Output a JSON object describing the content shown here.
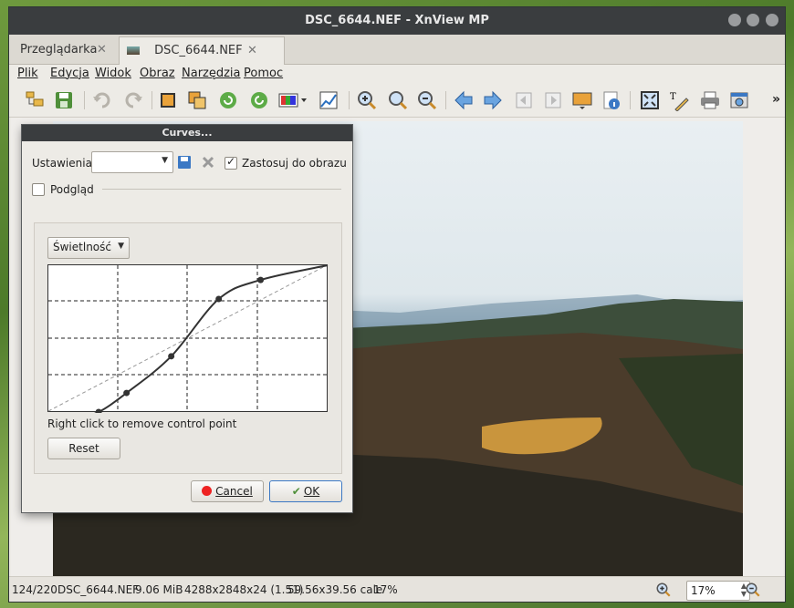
{
  "window": {
    "title": "DSC_6644.NEF - XnView MP"
  },
  "tabs": [
    {
      "label": "Przeglądarka"
    },
    {
      "label": "DSC_6644.NEF"
    }
  ],
  "menu": [
    "Plik",
    "Edycja",
    "Widok",
    "Obraz",
    "Narzędzia",
    "Pomoc"
  ],
  "toolbar": {
    "icons": [
      "folder-tree-icon",
      "save-icon",
      "undo-icon",
      "redo-icon",
      "crop-icon",
      "resize-icon",
      "rotate-left-icon",
      "rotate-right-icon",
      "color-adjust-icon",
      "levels-icon",
      "zoom-in-icon",
      "zoom-fit-icon",
      "zoom-out-icon",
      "prev-icon",
      "next-icon",
      "first-icon",
      "last-icon",
      "slideshow-icon",
      "info-icon",
      "fullscreen-icon",
      "text-edit-icon",
      "print-icon",
      "capture-icon"
    ],
    "overflow": "»"
  },
  "dialog": {
    "title": "Curves...",
    "settings_label": "Ustawienia:",
    "settings_value": "",
    "apply_label": "Zastosuj do obrazu",
    "apply_checked": true,
    "preview_label": "Podgląd",
    "preview_checked": false,
    "channel": "Świetlność",
    "hint": "Right click to remove control point",
    "reset_label": "Reset",
    "cancel_label": "Cancel",
    "ok_label": "OK",
    "curve_points": [
      [
        0.18,
        0.0
      ],
      [
        0.28,
        0.13
      ],
      [
        0.44,
        0.38
      ],
      [
        0.61,
        0.77
      ],
      [
        0.76,
        0.9
      ]
    ]
  },
  "status": {
    "index": "124/220",
    "filename": "DSC_6644.NEF",
    "size": "9.06 MiB",
    "dimensions": "4288x2848x24 (1.51)",
    "print_size": "59.56x39.56 cale",
    "zoom": "17%",
    "zoom_value": "17%"
  }
}
